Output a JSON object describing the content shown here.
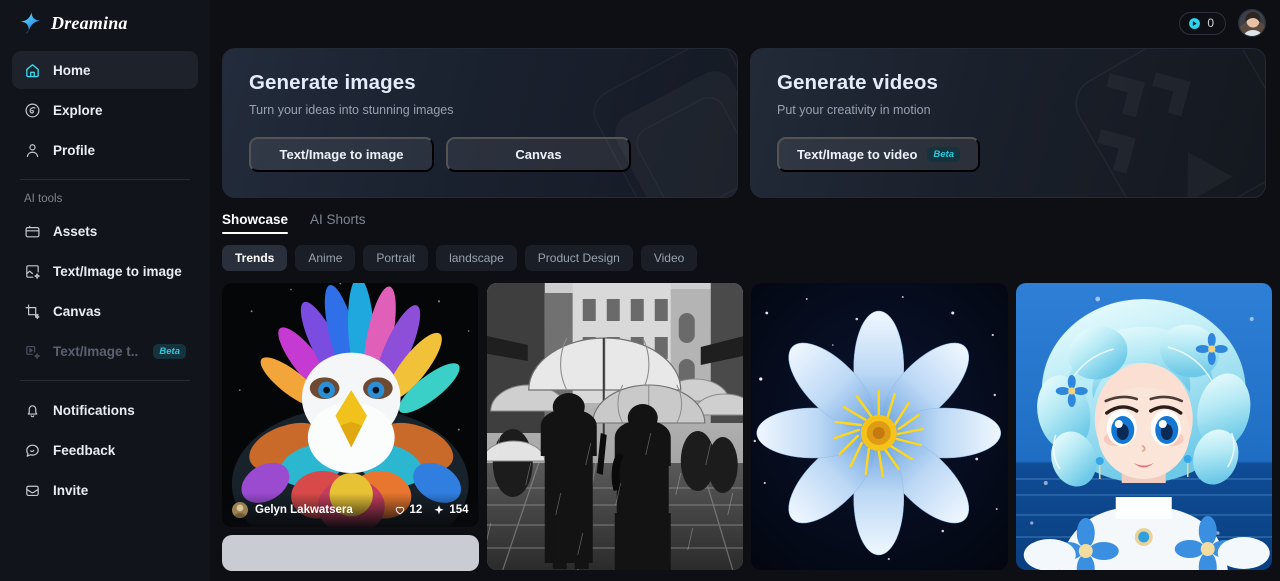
{
  "brand": {
    "name": "Dreamina",
    "logo_icon": "star-logo-icon",
    "accent": "#3ed8e8"
  },
  "topbar": {
    "credits": {
      "icon": "credit-coin-icon",
      "value": "0"
    },
    "avatar": {
      "icon": "user-avatar"
    }
  },
  "sidebar": {
    "primary": [
      {
        "label": "Home",
        "icon": "home-icon",
        "active": true
      },
      {
        "label": "Explore",
        "icon": "compass-icon",
        "active": false
      },
      {
        "label": "Profile",
        "icon": "person-icon",
        "active": false
      }
    ],
    "section_label": "AI tools",
    "tools": [
      {
        "label": "Assets",
        "icon": "folder-icon",
        "disabled": false,
        "badge": ""
      },
      {
        "label": "Text/Image to image",
        "icon": "image-sparkle-icon",
        "disabled": false,
        "badge": ""
      },
      {
        "label": "Canvas",
        "icon": "canvas-crop-icon",
        "disabled": false,
        "badge": ""
      },
      {
        "label": "Text/Image t...",
        "icon": "video-sparkle-icon",
        "disabled": true,
        "badge": "Beta"
      }
    ],
    "footer": [
      {
        "label": "Notifications",
        "icon": "bell-icon"
      },
      {
        "label": "Feedback",
        "icon": "chat-icon"
      },
      {
        "label": "Invite",
        "icon": "envelope-icon"
      }
    ]
  },
  "hero": [
    {
      "id": "generate-images",
      "title": "Generate images",
      "subtitle": "Turn your ideas into stunning images",
      "buttons": [
        {
          "label": "Text/Image to image",
          "badge": ""
        },
        {
          "label": "Canvas",
          "badge": ""
        }
      ]
    },
    {
      "id": "generate-videos",
      "title": "Generate videos",
      "subtitle": "Put your creativity in motion",
      "buttons": [
        {
          "label": "Text/Image to video",
          "badge": "Beta"
        }
      ]
    }
  ],
  "tabs": [
    {
      "label": "Showcase",
      "active": true
    },
    {
      "label": "AI Shorts",
      "active": false
    }
  ],
  "chips": [
    {
      "label": "Trends",
      "active": true
    },
    {
      "label": "Anime",
      "active": false
    },
    {
      "label": "Portrait",
      "active": false
    },
    {
      "label": "landscape",
      "active": false
    },
    {
      "label": "Product Design",
      "active": false
    },
    {
      "label": "Video",
      "active": false
    }
  ],
  "showcase": [
    {
      "id": "card-eagle",
      "alt": "Colorful rainbow-feathered bald eagle on dark starry background",
      "author": "Gelyn Lakwatsera",
      "likes": "12",
      "remixes": "154"
    },
    {
      "id": "card-rain-street",
      "alt": "Black and white photo of two people with umbrellas walking on a rainy city street"
    },
    {
      "id": "card-blue-flower",
      "alt": "Blue flower with yellow center on a starry night sky"
    },
    {
      "id": "card-anime-girl",
      "alt": "Anime girl with light blue curly hair and blue eyes by the sea"
    }
  ]
}
